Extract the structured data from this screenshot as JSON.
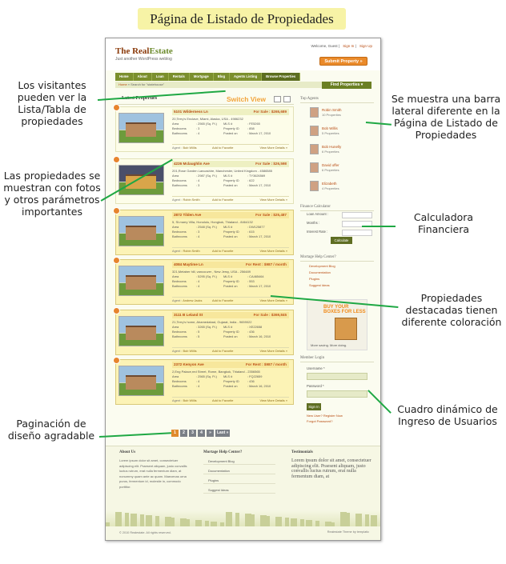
{
  "page_title": "Página de Listado de Propiedades",
  "annotations": {
    "list_view": "Los visitantes pueden ver la Lista/Tabla de propiedades",
    "photos": "Las propiedades se muestran con fotos y otros parámetros importantes",
    "pagination": "Paginación de diseño agradable",
    "sidebar": "Se muestra una barra lateral diferente en la Página de Listado de Propiedades",
    "calculator": "Calculadora Financiera",
    "featured": "Propiedades destacadas tienen diferente coloración",
    "login": "Cuadro dinámico de Ingreso de Usuarios"
  },
  "site": {
    "logo_part1": "The Real",
    "logo_part2": "Estate",
    "tagline": "Just another WordPress weblog",
    "welcome": "Welcome, Guest",
    "sign_in": "Sign In",
    "sign_up": "Sign Up",
    "submit": "Submit Property »"
  },
  "nav": [
    "Home",
    "About",
    "Loan",
    "Rentals",
    "Mortgage",
    "Blog",
    "Agents Listing",
    "Browse Properties"
  ],
  "breadcrumb": {
    "home": "Home",
    "current": "» Search for \"statehouse\""
  },
  "find_properties": "Find Properties ▾",
  "listing": {
    "title": "Latest Properties",
    "switch_view": "Switch View",
    "properties": [
      {
        "name": "5101 Wilderness Ln",
        "price": "For Sale : $265,689",
        "address": "20,Terry's Enclave, Miami, Alaska, USA - 4986232",
        "area": ": 2565 (Sq. Ft.)",
        "mls": ": FE5265",
        "bedrooms": ": 3",
        "property_id": ": 858",
        "bathrooms": ": 4",
        "posted": ": March 17, 2010",
        "agent": "Bob Willis",
        "featured": false
      },
      {
        "name": "4226 Mclaughlin Ave",
        "price": "For Sale : $26,598",
        "address": "201,Rose Garden Lancashire, Manchester, United Kingdom - 4586585",
        "area": ": 2987 (Sq. Ft.)",
        "mls": ": TY3626569",
        "bedrooms": ": 4",
        "property_id": ": 622",
        "bathrooms": ": 3",
        "posted": ": March 17, 2010",
        "agent": "Robin Smith",
        "featured": false
      },
      {
        "name": "2872 Tilden Ave",
        "price": "For Sale : $25,487",
        "address": "5, St.marry Villa, Honolulu, Hongkok, Thialand - 8464132",
        "area": ": 2548 (Sq. Ft.)",
        "mls": ": DW125877",
        "bedrooms": ": 3",
        "property_id": ": 615",
        "bathrooms": ": 4",
        "posted": ": March 17, 2010",
        "agent": "Robin Smith",
        "featured": true
      },
      {
        "name": "4084 Maytime Ln",
        "price": "For Rent : $987 / month",
        "address": "321,Metaber hill, vancouver , New Jersy, USA - 256489",
        "area": ": 5295 (Sq. Ft.)",
        "mls": ": CA465464",
        "bedrooms": ": 4",
        "property_id": ": 553",
        "bathrooms": ": 4",
        "posted": ": March 17, 2010",
        "agent": "Andrew Jacks",
        "featured": true
      },
      {
        "name": "3111 B Leland St",
        "price": "For Sale : $369,845",
        "address": "21,Terry's home, Ahamedabad, Gujarat, India - 9659022",
        "area": ": 3265 (Sq. Ft.)",
        "mls": ": XE22658",
        "bedrooms": ": 5",
        "property_id": ": 436",
        "bathrooms": ": 5",
        "posted": ": March 16, 2010",
        "agent": "Bob Willis",
        "featured": true
      },
      {
        "name": "2372 Kenyon Ave",
        "price": "For Rent : $987 / month",
        "address": "2,Eng Palace,red Street, Rome, Bangkok, Thialand - 2356565",
        "area": ": 2565 (Sq. Ft.)",
        "mls": ": FQ22659",
        "bedrooms": ": 4",
        "property_id": ": 436",
        "bathrooms": ": 4",
        "posted": ": March 16, 2010",
        "agent": "Bob Willis",
        "featured": true
      }
    ],
    "labels": {
      "area": "Area",
      "mls": "MLS #",
      "bedrooms": "Bedrooms",
      "property_id": "Property ID",
      "bathrooms": "Bathrooms",
      "posted": "Posted on",
      "agent": "Agent :",
      "fav": "Add to Favorite",
      "more": "View More Details »"
    }
  },
  "pagination": [
    "1",
    "2",
    "3",
    "4",
    "»",
    "Last »"
  ],
  "sidebar": {
    "top_agents": "Top Agents",
    "agents": [
      {
        "name": "Robin Smith",
        "props": "10 Properties"
      },
      {
        "name": "Bob Willis",
        "props": "5 Properties"
      },
      {
        "name": "Bob Hunelly",
        "props": "6 Properties"
      },
      {
        "name": "David offer",
        "props": "6 Properties"
      },
      {
        "name": "Elizabeth",
        "props": "4 Properties"
      }
    ],
    "finance_title": "Finance Calculator",
    "loan_label": "Loan Amount :",
    "months_label": "Months :",
    "interest_label": "Interest Rate :",
    "calculate": "Calculate",
    "mhc_title": "Mortage Help Center?",
    "mhc_items": [
      "Development Blog",
      "Documentation",
      "Plugins",
      "Suggest Ideas"
    ],
    "ad_text": "BUY YOUR BOXES FOR LESS",
    "ad_sub": "More saving. More doing.",
    "login_title": "Member Login",
    "username": "Username *",
    "password": "Password *",
    "signin": "Sign In",
    "new_user": "New User? Register Now",
    "forgot": "Forgot Password?"
  },
  "footer": {
    "about_title": "About Us",
    "about_text": "Lorem ipsum dolor sit amet, consectetuer adipiscing elit. Praesent aliquam, justo convallis luctus rutrum, erat nulla fermentum diam, at nonummy quam ante ac quam. Maecenas urna purus, fermentum id, molestie in, commodo porttitor.",
    "help_title": "Mortage Help Center?",
    "help_items": [
      "Development Blog",
      "Documentation",
      "Plugins",
      "Suggest Ideas"
    ],
    "testimonial_title": "Testimonials",
    "testimonial": "Lorem ipsum dolor sit amet, consectetuer adipiscing elit. Praesent aliquam, justo convallis luctus rutrum, erat nulla fermentum diam, at",
    "copyright": "© 2010 Realestate. All rights reserved.",
    "theme": "Realestate Theme by  templatic"
  }
}
